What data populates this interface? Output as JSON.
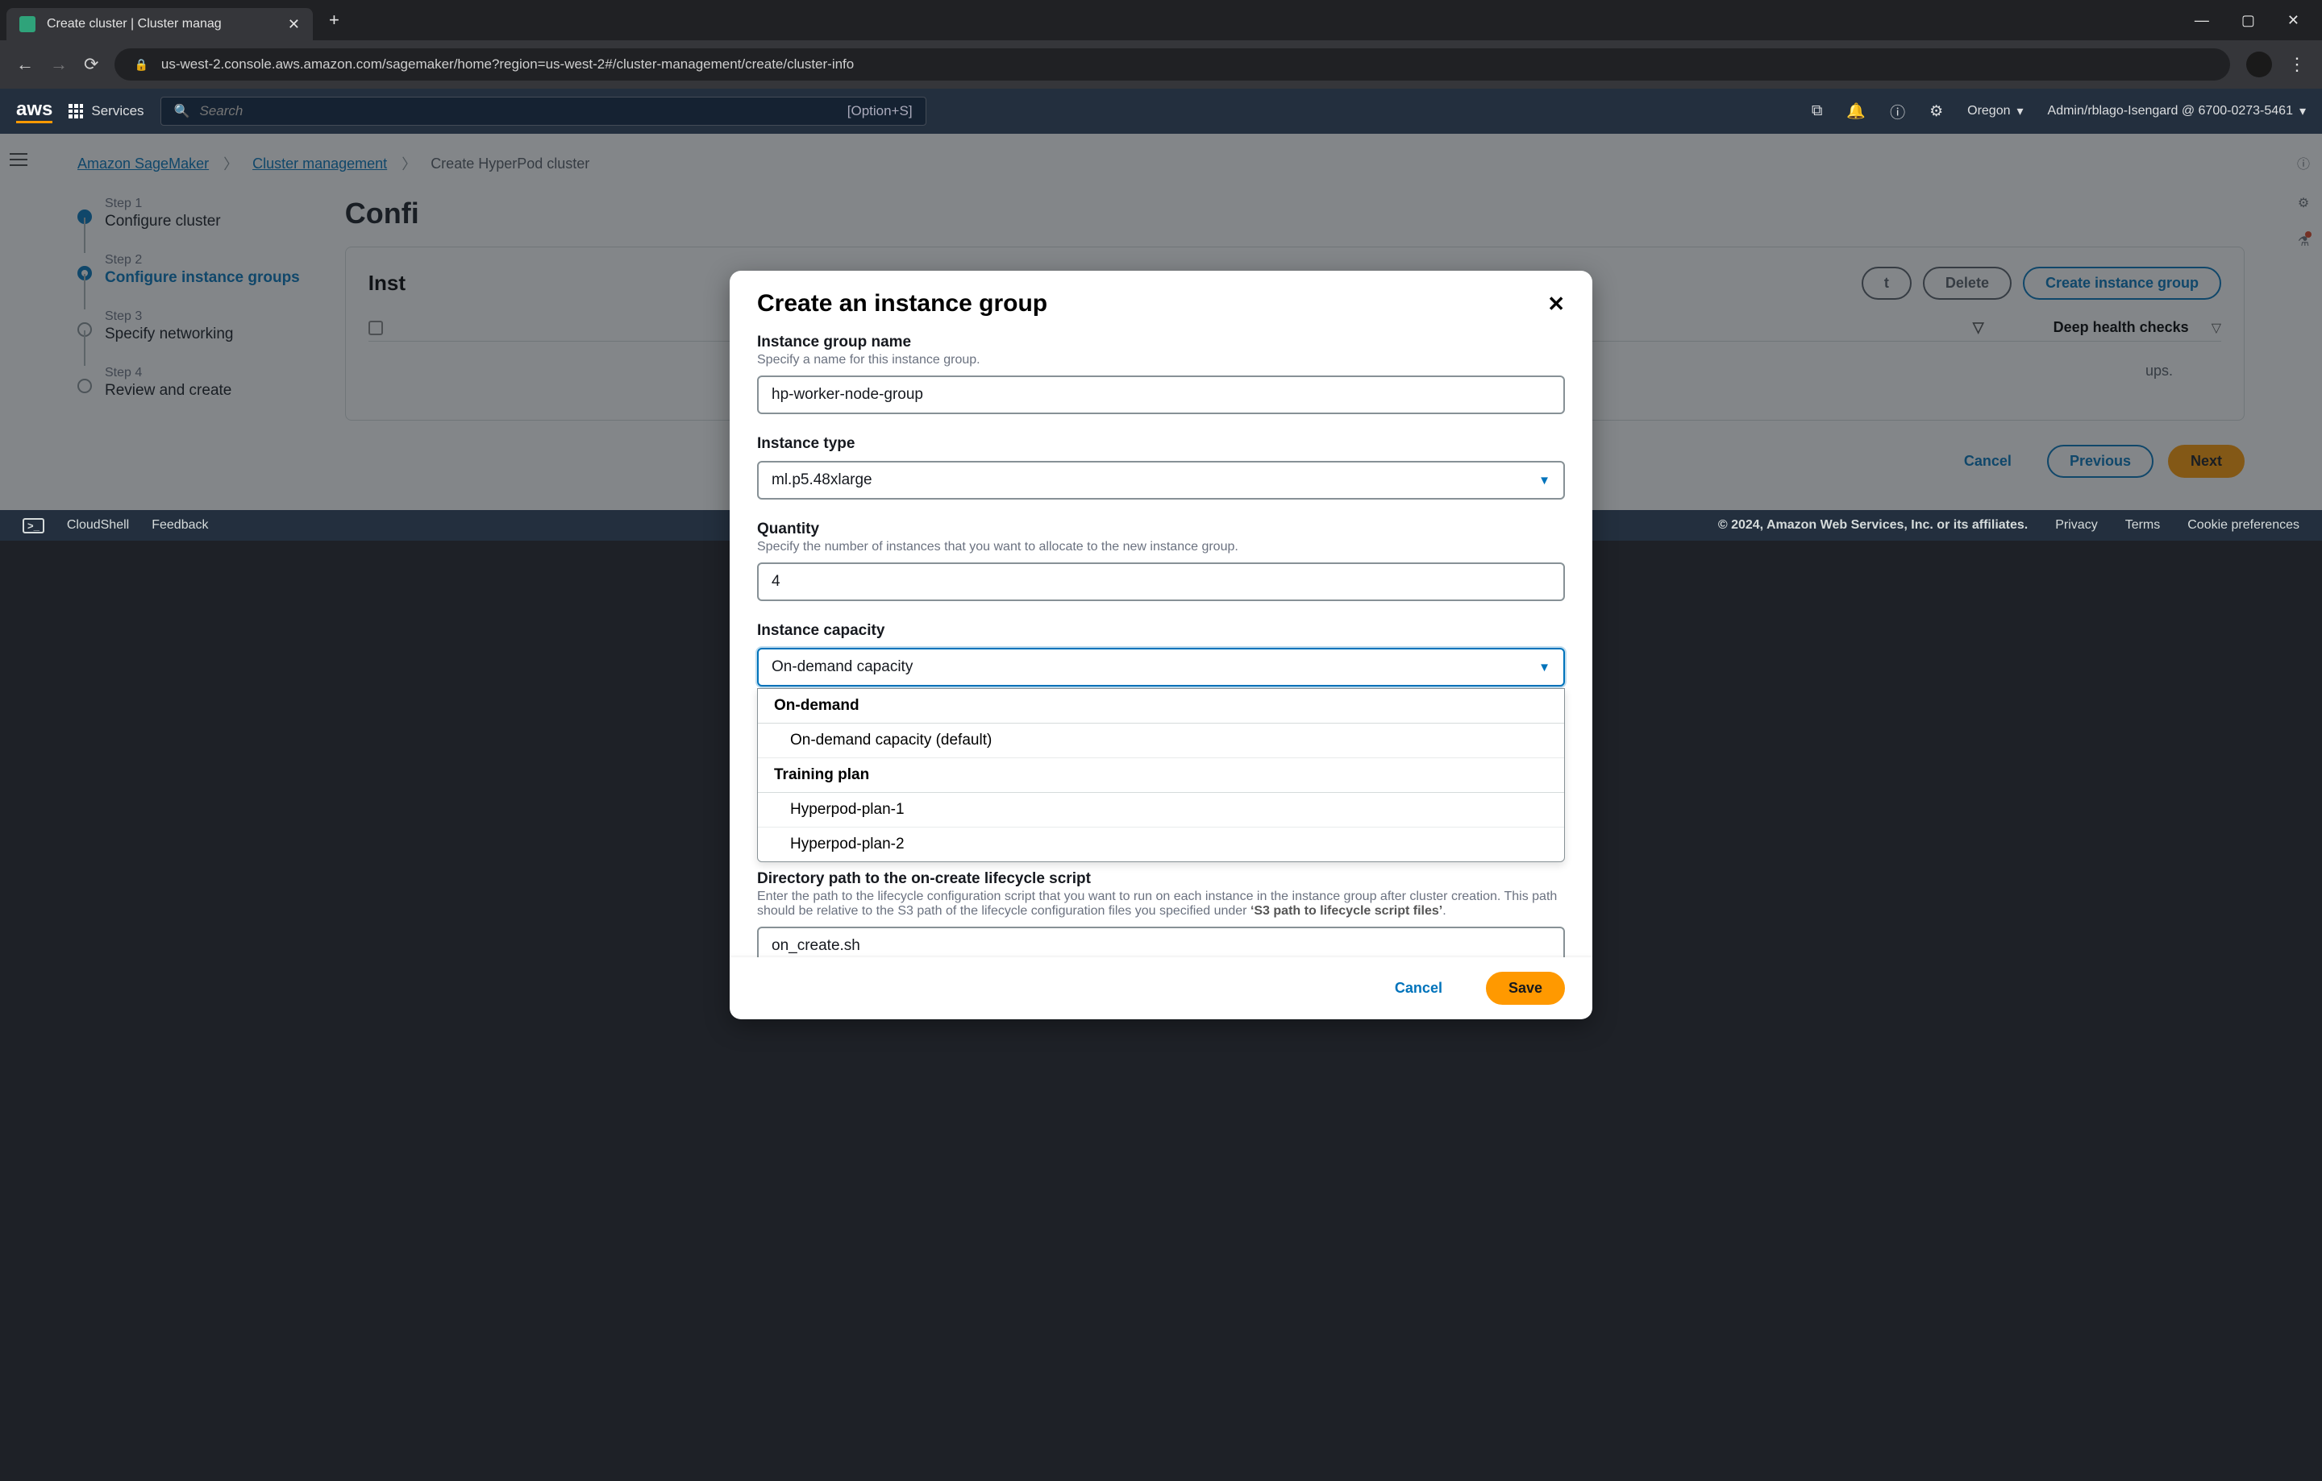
{
  "browser": {
    "tab_title": "Create cluster | Cluster manag",
    "url": "us-west-2.console.aws.amazon.com/sagemaker/home?region=us-west-2#/cluster-management/create/cluster-info"
  },
  "aws_header": {
    "services": "Services",
    "search_placeholder": "Search",
    "shortcut": "[Option+S]",
    "region": "Oregon",
    "user": "Admin/rblago-Isengard @ 6700-0273-5461"
  },
  "breadcrumbs": {
    "root": "Amazon SageMaker",
    "mid": "Cluster management",
    "leaf": "Create HyperPod cluster"
  },
  "steps": [
    {
      "small": "Step 1",
      "label": "Configure cluster"
    },
    {
      "small": "Step 2",
      "label": "Configure instance groups"
    },
    {
      "small": "Step 3",
      "label": "Specify networking"
    },
    {
      "small": "Step 4",
      "label": "Review and create"
    }
  ],
  "page_title_partial": "Confi",
  "panel": {
    "title_partial": "Inst",
    "edit_btn_partial": "t",
    "delete_btn": "Delete",
    "create_btn": "Create instance group",
    "deep_health_col": "Deep health checks",
    "empty_suffix": "ups."
  },
  "wizard_footer": {
    "cancel": "Cancel",
    "previous": "Previous",
    "next": "Next"
  },
  "modal": {
    "title": "Create an instance group",
    "group_name_label": "Instance group name",
    "group_name_desc": "Specify a name for this instance group.",
    "group_name_value": "hp-worker-node-group",
    "instance_type_label": "Instance type",
    "instance_type_value": "ml.p5.48xlarge",
    "quantity_label": "Quantity",
    "quantity_desc": "Specify the number of instances that you want to allocate to the new instance group.",
    "quantity_value": "4",
    "capacity_label": "Instance capacity",
    "capacity_value": "On-demand capacity",
    "capacity_options": {
      "group1_label": "On-demand",
      "group1_opt1": "On-demand capacity (default)",
      "group2_label": "Training plan",
      "group2_opt1": "Hyperpod-plan-1",
      "group2_opt2": "Hyperpod-plan-2"
    },
    "lifecycle_label": "Directory path to the on-create lifecycle script",
    "lifecycle_desc_1": "Enter the path to the lifecycle configuration script that you want to run on each instance in the instance group after cluster creation. This path should be relative to the S3 path of the lifecycle configuration files you specified under ",
    "lifecycle_desc_2": "‘S3 path to lifecycle script files’",
    "lifecycle_value_partial": "on_create.sh",
    "cancel": "Cancel",
    "save": "Save"
  },
  "footer": {
    "cloudshell": "CloudShell",
    "feedback": "Feedback",
    "copyright": "© 2024, Amazon Web Services, Inc. or its affiliates.",
    "privacy": "Privacy",
    "terms": "Terms",
    "cookies": "Cookie preferences"
  }
}
